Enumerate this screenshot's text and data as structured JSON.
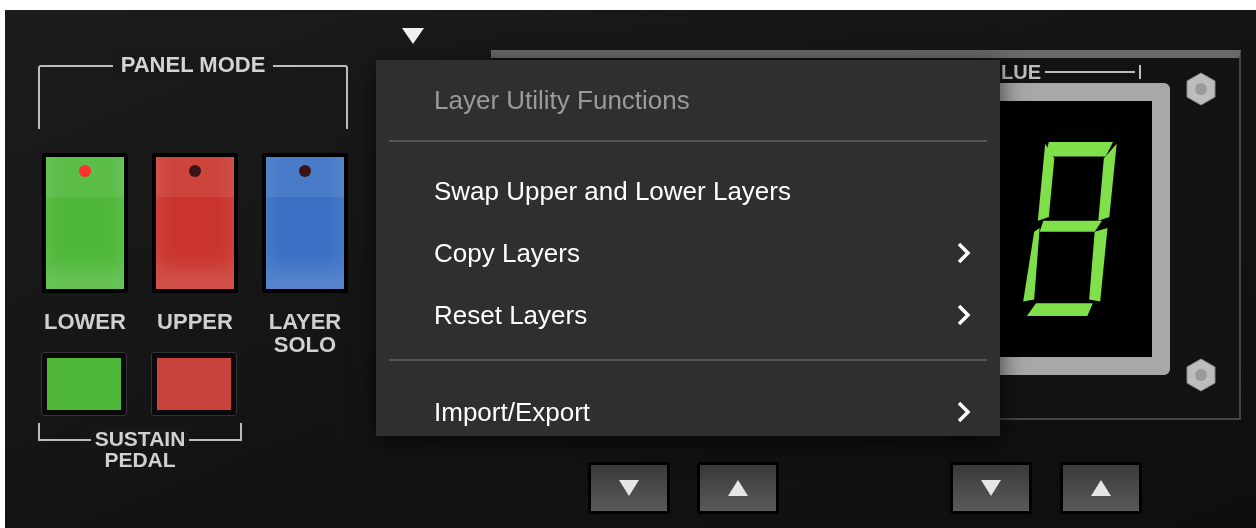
{
  "panel_mode": {
    "title": "PANEL MODE",
    "buttons": [
      {
        "label_lines": [
          "LOWER"
        ],
        "color": "#4fb83a",
        "lit": true
      },
      {
        "label_lines": [
          "UPPER"
        ],
        "color": "#c9352d",
        "lit": false
      },
      {
        "label_lines": [
          "LAYER",
          "SOLO"
        ],
        "color": "#3a70c4",
        "lit": false
      }
    ]
  },
  "sustain_pedal": {
    "title_lines": [
      "SUSTAIN",
      "PEDAL"
    ],
    "buttons": [
      {
        "color": "#4fb83a"
      },
      {
        "color": "#c8433c"
      }
    ]
  },
  "value_display": {
    "title": "LUE"
  },
  "menu": {
    "header": "Layer Utility Functions",
    "sections": [
      [
        {
          "label": "Swap Upper and Lower Layers",
          "submenu": false
        },
        {
          "label": "Copy Layers",
          "submenu": true
        },
        {
          "label": "Reset Layers",
          "submenu": true
        }
      ],
      [
        {
          "label": "Import/Export",
          "submenu": true
        }
      ]
    ]
  }
}
